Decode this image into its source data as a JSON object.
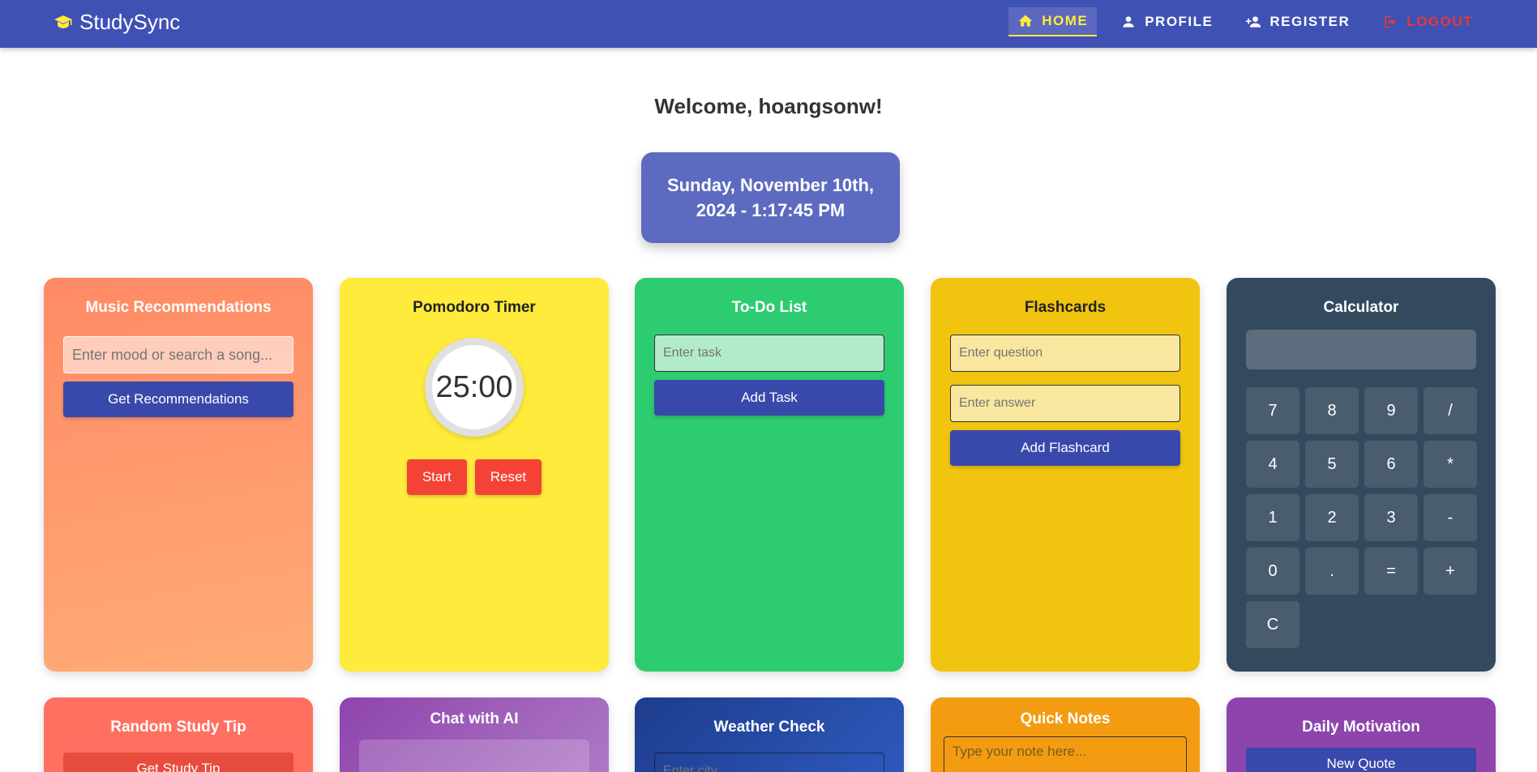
{
  "brand": {
    "name": "StudySync",
    "icon": "graduation-cap-icon"
  },
  "nav": {
    "home": "HOME",
    "profile": "PROFILE",
    "register": "REGISTER",
    "logout": "LOGOUT"
  },
  "welcome": "Welcome, hoangsonw!",
  "datetime": "Sunday, November 10th, 2024 - 1:17:45 PM",
  "music": {
    "title": "Music Recommendations",
    "placeholder": "Enter mood or search a song...",
    "button": "Get Recommendations"
  },
  "pomodoro": {
    "title": "Pomodoro Timer",
    "time": "25:00",
    "start": "Start",
    "reset": "Reset"
  },
  "todo": {
    "title": "To-Do List",
    "placeholder": "Enter task",
    "button": "Add Task"
  },
  "flashcards": {
    "title": "Flashcards",
    "question_placeholder": "Enter question",
    "answer_placeholder": "Enter answer",
    "button": "Add Flashcard"
  },
  "calculator": {
    "title": "Calculator",
    "display": "",
    "keys": [
      "7",
      "8",
      "9",
      "/",
      "4",
      "5",
      "6",
      "*",
      "1",
      "2",
      "3",
      "-",
      "0",
      ".",
      "=",
      "+",
      "C"
    ]
  },
  "tip": {
    "title": "Random Study Tip",
    "button": "Get Study Tip"
  },
  "chat": {
    "title": "Chat with AI"
  },
  "weather": {
    "title": "Weather Check",
    "placeholder": "Enter city..."
  },
  "notes": {
    "title": "Quick Notes",
    "placeholder": "Type your note here..."
  },
  "motivation": {
    "title": "Daily Motivation",
    "button": "New Quote"
  },
  "colors": {
    "navbar": "#3f51b5",
    "active_nav": "#ffeb3b",
    "logout": "#e53935",
    "primary_button": "#3949ab"
  }
}
